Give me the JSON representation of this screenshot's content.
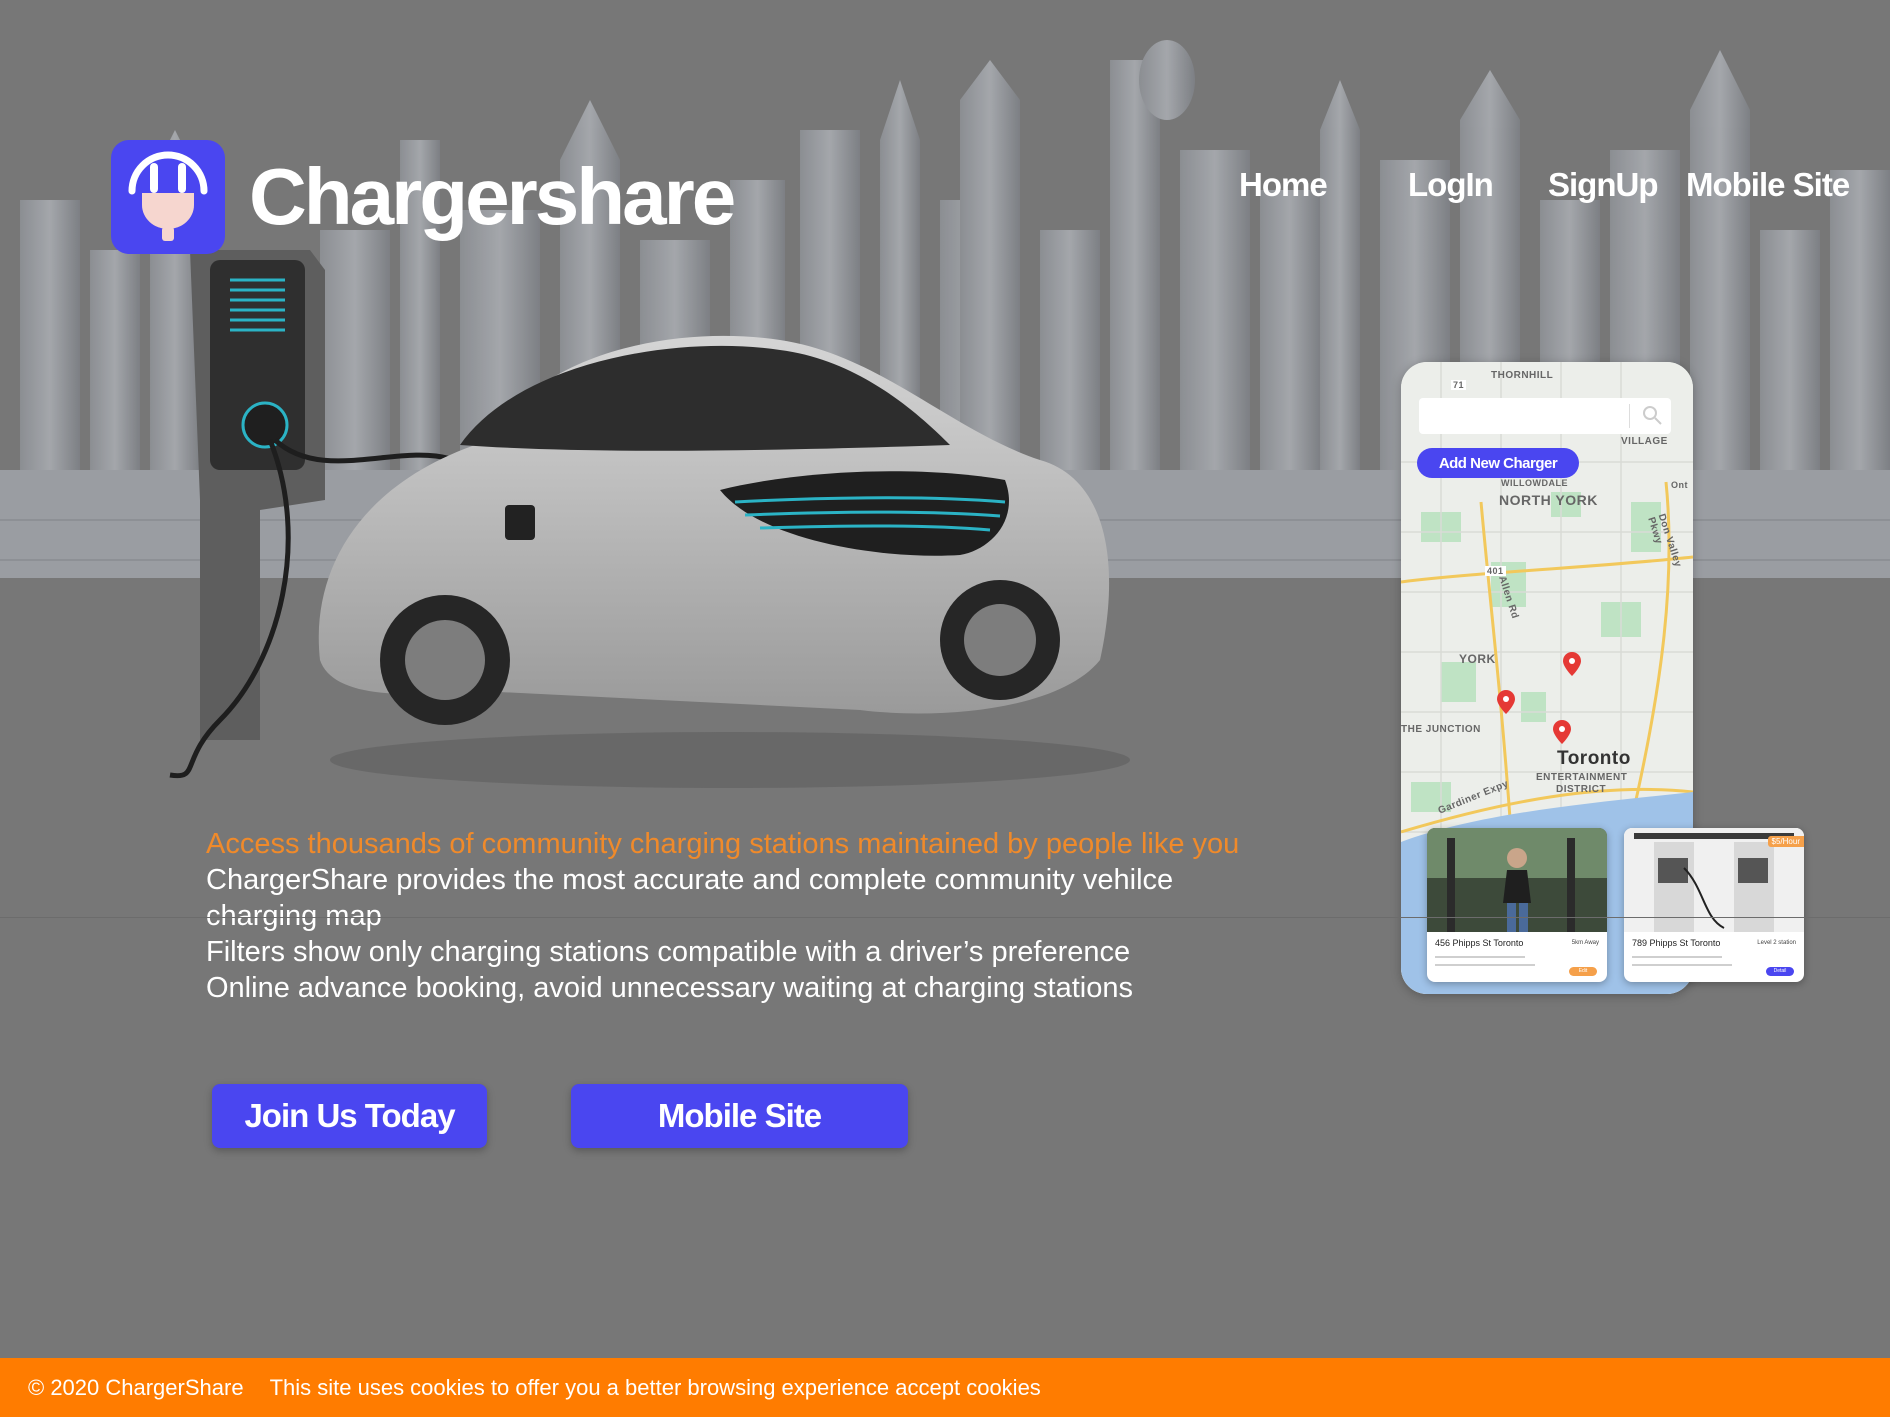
{
  "header": {
    "brand": "Chargershare",
    "logo_icon": "plug-face-icon",
    "nav": [
      {
        "label": "Home"
      },
      {
        "label": "LogIn"
      },
      {
        "label": "SignUp"
      },
      {
        "label": "Mobile Site"
      }
    ]
  },
  "hero": {
    "tagline": "Access thousands of community charging stations maintained by people like you",
    "lines": [
      "ChargerShare provides the most accurate and complete community vehilce charging map",
      "Filters show only charging stations compatible with a driver’s preference",
      "Online advance booking, avoid unnecessary waiting at charging stations"
    ],
    "buttons": {
      "join": "Join Us Today",
      "mobile": "Mobile Site"
    }
  },
  "phone": {
    "add_button": "Add New Charger",
    "search_icon": "search-icon",
    "map_labels": {
      "thornhill": "THORNHILL",
      "north_york": "NORTH YORK",
      "york": "YORK",
      "junction": "THE JUNCTION",
      "toronto": "Toronto",
      "entertainment": "ENTERTAINMENT",
      "district": "DISTRICT",
      "village": "VILLAGE",
      "willowdale": "WILLOWDALE",
      "allen_rd": "Allen Rd",
      "don_valley": "Don Valley Pkwy",
      "gardiner": "Gardiner Expy",
      "hwy401": "401",
      "hwy71": "71",
      "ont": "Ont"
    },
    "cards": [
      {
        "address": "456 Phipps St Toronto",
        "meta": "5km Away",
        "pill": "Edit"
      },
      {
        "address": "789 Phipps St Toronto",
        "meta": "Level 2 station",
        "pill": "Detail",
        "price": "$5/Hour"
      }
    ]
  },
  "colors": {
    "accent": "#4a46f0",
    "orange": "#ff7c00",
    "tagline": "#f08a2a",
    "background": "#777777"
  },
  "footer": {
    "copyright": "© 2020 ChargerShare",
    "cookies": "This site uses cookies to offer you a better browsing experience accept cookies"
  }
}
